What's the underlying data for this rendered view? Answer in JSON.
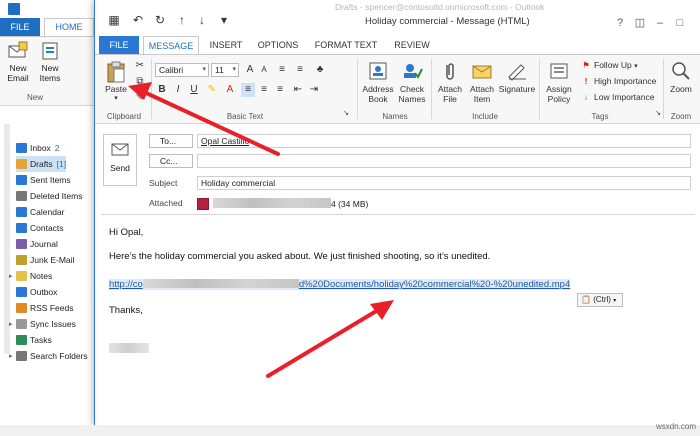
{
  "back_window": {
    "tabs": {
      "file": "FILE",
      "home": "HOME"
    },
    "ribbon": {
      "new_email": "New\nEmail",
      "new_items": "New\nItems",
      "group_new": "New"
    },
    "folders": [
      {
        "label": "Inbox",
        "count": "2"
      },
      {
        "label": "Drafts",
        "count": "[1]"
      },
      {
        "label": "Sent Items",
        "count": ""
      },
      {
        "label": "Deleted Items",
        "count": ""
      },
      {
        "label": "Calendar",
        "count": ""
      },
      {
        "label": "Contacts",
        "count": ""
      },
      {
        "label": "Journal",
        "count": ""
      },
      {
        "label": "Junk E-Mail",
        "count": ""
      },
      {
        "label": "Notes",
        "count": ""
      },
      {
        "label": "Outbox",
        "count": ""
      },
      {
        "label": "RSS Feeds",
        "count": ""
      },
      {
        "label": "Sync Issues",
        "count": ""
      },
      {
        "label": "Tasks",
        "count": ""
      },
      {
        "label": "Search Folders",
        "count": ""
      }
    ]
  },
  "message_window": {
    "title": "Holiday commercial - Message (HTML)",
    "faint_title": "Drafts - spencer@contosoltd.onmicrosoft.com - Outlook",
    "tabs": [
      "FILE",
      "MESSAGE",
      "INSERT",
      "OPTIONS",
      "FORMAT TEXT",
      "REVIEW"
    ],
    "ribbon": {
      "paste": "Paste",
      "clipboard_group": "Clipboard",
      "font_name": "Calibri",
      "font_size": "11",
      "basic_text_group": "Basic Text",
      "address_book": "Address\nBook",
      "check_names": "Check\nNames",
      "names_group": "Names",
      "attach_file": "Attach\nFile",
      "attach_item": "Attach\nItem",
      "signature": "Signature",
      "include_group": "Include",
      "assign_policy": "Assign\nPolicy",
      "follow_up": "Follow Up",
      "high_importance": "High Importance",
      "low_importance": "Low Importance",
      "tags_group": "Tags",
      "zoom": "Zoom",
      "zoom_group": "Zoom"
    },
    "compose": {
      "send": "Send",
      "to_button": "To...",
      "cc_button": "Cc...",
      "to_value": "Opal Castillo",
      "subject_label": "Subject",
      "subject_value": "Holiday commercial",
      "attached_label": "Attached",
      "attachment_size": "4 (34 MB)",
      "body_greeting": "Hi Opal,",
      "body_text": "Here’s the holiday commercial you asked about. We just finished shooting, so it’s unedited.",
      "link_start": "http://co",
      "link_mid": "d%20Documents/holiday%20commercial%20-%20unedited.mp4",
      "thanks": "Thanks,",
      "paste_options": "(Ctrl)"
    }
  },
  "watermark": "wsxdn.com",
  "colors": {
    "accent_blue": "#2b78d4",
    "arrow_red": "#e8202a",
    "attach_red": "#b8203c"
  }
}
